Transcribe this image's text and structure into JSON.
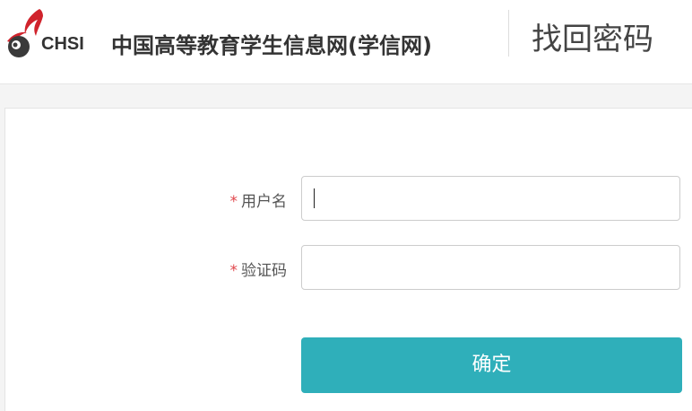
{
  "header": {
    "logo_text": "CHSI",
    "site_name": "中国高等教育学生信息网(学信网)",
    "page_heading": "找回密码"
  },
  "form": {
    "required_mark": "*",
    "username_label": "用户名",
    "username_value": "",
    "captcha_label": "验证码",
    "captcha_value": "",
    "submit_label": "确定"
  },
  "colors": {
    "accent": "#2fafba",
    "required": "#e0464b",
    "logo_red": "#d0232c"
  }
}
